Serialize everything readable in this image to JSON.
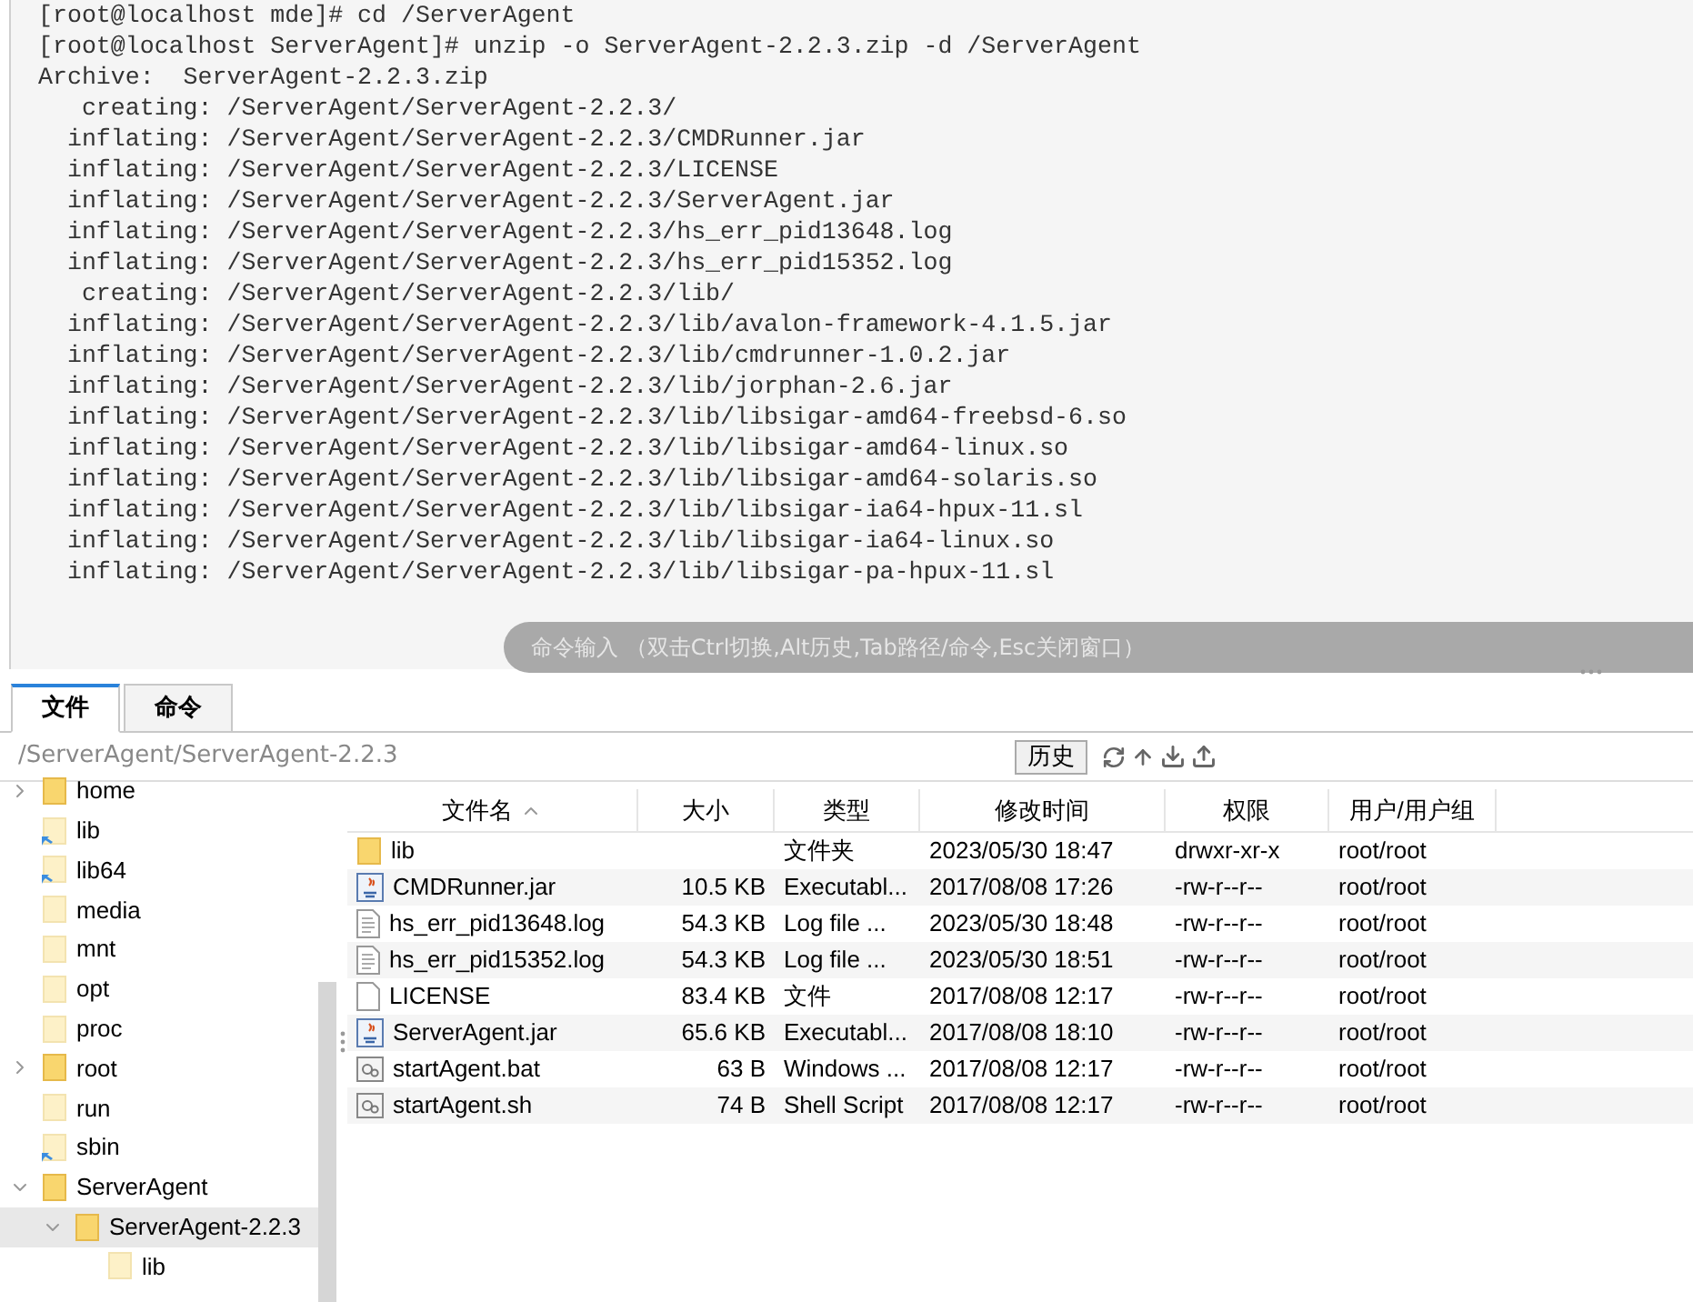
{
  "terminal": {
    "lines": [
      "[root@localhost mde]# cd /ServerAgent",
      "[root@localhost ServerAgent]# unzip -o ServerAgent-2.2.3.zip -d /ServerAgent",
      "Archive:  ServerAgent-2.2.3.zip",
      "   creating: /ServerAgent/ServerAgent-2.2.3/",
      "  inflating: /ServerAgent/ServerAgent-2.2.3/CMDRunner.jar",
      "  inflating: /ServerAgent/ServerAgent-2.2.3/LICENSE",
      "  inflating: /ServerAgent/ServerAgent-2.2.3/ServerAgent.jar",
      "  inflating: /ServerAgent/ServerAgent-2.2.3/hs_err_pid13648.log",
      "  inflating: /ServerAgent/ServerAgent-2.2.3/hs_err_pid15352.log",
      "   creating: /ServerAgent/ServerAgent-2.2.3/lib/",
      "  inflating: /ServerAgent/ServerAgent-2.2.3/lib/avalon-framework-4.1.5.jar",
      "  inflating: /ServerAgent/ServerAgent-2.2.3/lib/cmdrunner-1.0.2.jar",
      "  inflating: /ServerAgent/ServerAgent-2.2.3/lib/jorphan-2.6.jar",
      "  inflating: /ServerAgent/ServerAgent-2.2.3/lib/libsigar-amd64-freebsd-6.so",
      "  inflating: /ServerAgent/ServerAgent-2.2.3/lib/libsigar-amd64-linux.so",
      "  inflating: /ServerAgent/ServerAgent-2.2.3/lib/libsigar-amd64-solaris.so",
      "  inflating: /ServerAgent/ServerAgent-2.2.3/lib/libsigar-ia64-hpux-11.sl",
      "  inflating: /ServerAgent/ServerAgent-2.2.3/lib/libsigar-ia64-linux.so",
      "  inflating: /ServerAgent/ServerAgent-2.2.3/lib/libsigar-pa-hpux-11.sl"
    ],
    "command_input": {
      "placeholder": "命令输入 （双击Ctrl切换,Alt历史,Tab路径/命令,Esc关闭窗口）"
    }
  },
  "tabs": [
    {
      "label": "文件",
      "selected": true
    },
    {
      "label": "命令",
      "selected": false
    }
  ],
  "path_bar": {
    "path": "/ServerAgent/ServerAgent-2.2.3",
    "history_button": "历史"
  },
  "tree": [
    {
      "name": "home",
      "kind": "folder",
      "expanded": false,
      "selected": false
    },
    {
      "name": "lib",
      "kind": "link",
      "selected": false
    },
    {
      "name": "lib64",
      "kind": "link",
      "selected": false
    },
    {
      "name": "media",
      "kind": "empty",
      "selected": false
    },
    {
      "name": "mnt",
      "kind": "empty",
      "selected": false
    },
    {
      "name": "opt",
      "kind": "empty",
      "selected": false
    },
    {
      "name": "proc",
      "kind": "empty",
      "selected": false
    },
    {
      "name": "root",
      "kind": "folder",
      "expanded": false,
      "selected": false
    },
    {
      "name": "run",
      "kind": "empty",
      "selected": false
    },
    {
      "name": "sbin",
      "kind": "link",
      "selected": false
    },
    {
      "name": "ServerAgent",
      "kind": "folder",
      "expanded": true,
      "selected": false,
      "children": [
        {
          "name": "ServerAgent-2.2.3",
          "kind": "folder",
          "expanded": true,
          "selected": true,
          "children": [
            {
              "name": "lib",
              "kind": "empty",
              "selected": false
            }
          ]
        }
      ]
    }
  ],
  "table": {
    "columns": [
      "文件名",
      "大小",
      "类型",
      "修改时间",
      "权限",
      "用户/用户组"
    ],
    "rows": [
      {
        "kind": "folder",
        "cells": [
          "lib",
          "",
          "文件夹",
          "2023/05/30 18:47",
          "drwxr-xr-x",
          "root/root"
        ]
      },
      {
        "kind": "jar",
        "cells": [
          "CMDRunner.jar",
          "10.5 KB",
          "Executabl...",
          "2017/08/08 17:26",
          "-rw-r--r--",
          "root/root"
        ]
      },
      {
        "kind": "log",
        "cells": [
          "hs_err_pid13648.log",
          "54.3 KB",
          "Log file ...",
          "2023/05/30 18:48",
          "-rw-r--r--",
          "root/root"
        ]
      },
      {
        "kind": "log",
        "cells": [
          "hs_err_pid15352.log",
          "54.3 KB",
          "Log file ...",
          "2023/05/30 18:51",
          "-rw-r--r--",
          "root/root"
        ]
      },
      {
        "kind": "file",
        "cells": [
          "LICENSE",
          "83.4 KB",
          "文件",
          "2017/08/08 12:17",
          "-rw-r--r--",
          "root/root"
        ]
      },
      {
        "kind": "jar",
        "cells": [
          "ServerAgent.jar",
          "65.6 KB",
          "Executabl...",
          "2017/08/08 18:10",
          "-rw-r--r--",
          "root/root"
        ]
      },
      {
        "kind": "script",
        "cells": [
          "startAgent.bat",
          "63 B",
          "Windows ...",
          "2017/08/08 12:17",
          "-rw-r--r--",
          "root/root"
        ]
      },
      {
        "kind": "script",
        "cells": [
          "startAgent.sh",
          "74 B",
          "Shell Script",
          "2017/08/08 12:17",
          "-rw-r--r--",
          "root/root"
        ]
      }
    ]
  }
}
